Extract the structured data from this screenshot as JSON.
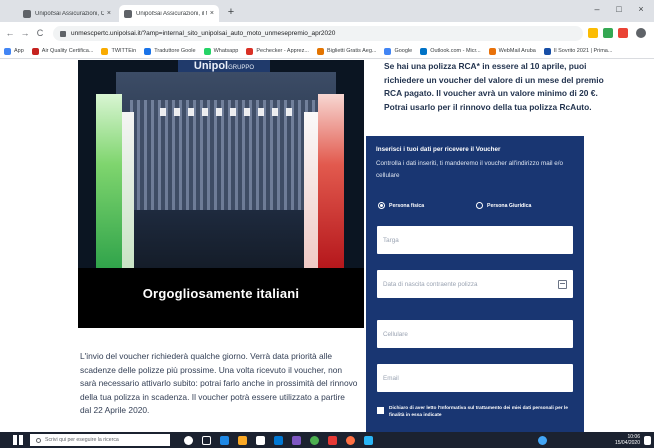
{
  "browser": {
    "tabs": [
      {
        "label": "UnipolSai Assicurazioni, Compagn",
        "active": false
      },
      {
        "label": "UnipolSai Assicurazioni, il titolo ·",
        "active": true
      }
    ],
    "new_tab": "+",
    "window_controls": {
      "minimize": "–",
      "maximize": "□",
      "close": "×"
    },
    "nav": {
      "back": "←",
      "forward": "→",
      "reload": "C"
    },
    "url": "unmescpertc.unipolsai.it/?amp=internal_sito_unipolsai_auto_moto_unmesepremio_apr2020"
  },
  "bookmarks": [
    {
      "label": "App",
      "color": "#4285f4"
    },
    {
      "label": "Air Quality Certifica...",
      "color": "#c5221f"
    },
    {
      "label": "TWITTEin",
      "color": "#f9ab00"
    },
    {
      "label": "Traduttore Goole",
      "color": "#1a73e8"
    },
    {
      "label": "Whatsapp",
      "color": "#25d366"
    },
    {
      "label": "Pechecker - Apprez...",
      "color": "#d93025"
    },
    {
      "label": "Biglietti Gratis Aeg...",
      "color": "#e37400"
    },
    {
      "label": "Google",
      "color": "#4285f4"
    },
    {
      "label": "Outlook.com - Micr...",
      "color": "#0072c6"
    },
    {
      "label": "WebMail Aruba",
      "color": "#e8710a"
    },
    {
      "label": "Il Sovrito 2021 | Prima...",
      "color": "#174ea6"
    }
  ],
  "page": {
    "hero": {
      "logo": "Unipol",
      "logo_sub": "GRUPPO",
      "caption": "Orgogliosamente italiani"
    },
    "intro": "Se hai una polizza RCA* in essere al 10 aprile, puoi richiedere un voucher del valore di un mese del premio RCA pagato. Il voucher avrà un valore minimo di 20 €. Potrai usarlo per il rinnovo della tua polizza RcAuto.",
    "body": "L'invio del voucher richiederà qualche giorno. Verrà data priorità alle scadenze delle polizze più prossime. Una volta ricevuto il voucher, non sarà necessario attivarlo subito: potrai farlo anche in prossimità del rinnovo della tua polizza in scadenza. Il voucher potrà essere utilizzato a partire dal 22 Aprile 2020.",
    "form": {
      "title": "Inserisci i tuoi dati per ricevere il Voucher",
      "description": "Controlla i dati inseriti, ti manderemo il voucher all'indirizzo mail e/o cellulare",
      "radio_person": "Persona fisica",
      "radio_company": "Persona Giuridica",
      "radio_selected": "person",
      "fields": {
        "plate": "Targa",
        "date": "Data di nascita contraente polizza",
        "mobile": "Cellulare",
        "email": "Email"
      },
      "consent": "Dichiaro di aver letto l'Informativa sul trattamento dei miei dati personali per le finalità in essa indicate"
    }
  },
  "taskbar": {
    "search_placeholder": "Scrivi qui per eseguire la ricerca",
    "time": "10:06",
    "date": "15/04/2020"
  },
  "colors": {
    "form_bg": "#193672",
    "hero_bg": "#0b1522",
    "text": "#23344f"
  }
}
